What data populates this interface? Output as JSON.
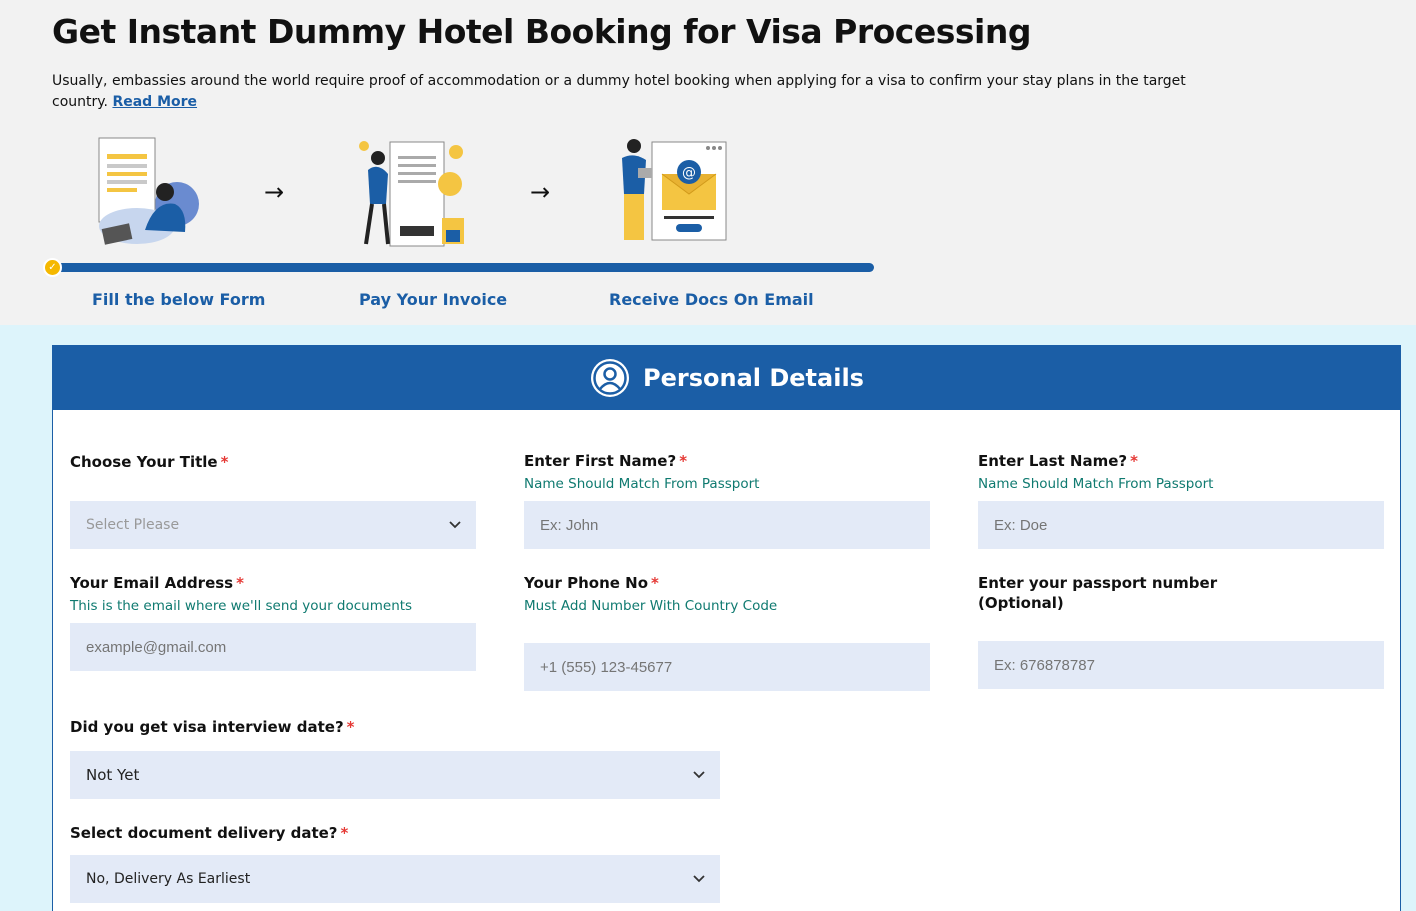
{
  "header": {
    "title": "Get Instant Dummy Hotel Booking for Visa Processing",
    "intro": "Usually, embassies around the world require proof of accommodation or a dummy hotel booking when applying for a visa to confirm your stay plans in the target country.",
    "read_more": "Read More"
  },
  "steps": [
    {
      "label": "Fill the below Form",
      "icon": "form-filling-illustration"
    },
    {
      "label": "Pay Your Invoice",
      "icon": "invoice-payment-illustration"
    },
    {
      "label": "Receive Docs On Email",
      "icon": "email-delivery-illustration"
    }
  ],
  "progress": {
    "current_step": 1,
    "total_steps": 3
  },
  "form": {
    "section_title": "Personal Details",
    "section_icon": "user-avatar-icon",
    "title_field": {
      "label": "Choose Your Title",
      "placeholder": "Select Please"
    },
    "first_name": {
      "label": "Enter First Name?",
      "hint": "Name Should Match From Passport",
      "placeholder": "Ex: John"
    },
    "last_name": {
      "label": "Enter Last Name?",
      "hint": "Name Should Match From Passport",
      "placeholder": "Ex: Doe"
    },
    "email": {
      "label": "Your Email Address",
      "hint": "This is the email where we'll send your documents",
      "placeholder": "example@gmail.com"
    },
    "phone": {
      "label": "Your Phone No",
      "hint": "Must Add Number With Country Code",
      "placeholder": "+1 (555) 123-45677"
    },
    "passport": {
      "label_line1": "Enter your passport number",
      "label_line2": "(Optional)",
      "placeholder": "Ex: 676878787"
    },
    "interview": {
      "label": "Did you get visa interview date?",
      "value": "Not Yet"
    },
    "delivery": {
      "label": "Select document delivery date?",
      "value": "No, Delivery As Earliest"
    },
    "required_mark": "*"
  },
  "colors": {
    "brand_blue": "#1b5ea6",
    "accent_yellow": "#f5b800",
    "hint_teal": "#0f7a70",
    "required_red": "#e53935",
    "input_bg": "#e3eaf7",
    "form_bg": "#ddf4fb"
  }
}
